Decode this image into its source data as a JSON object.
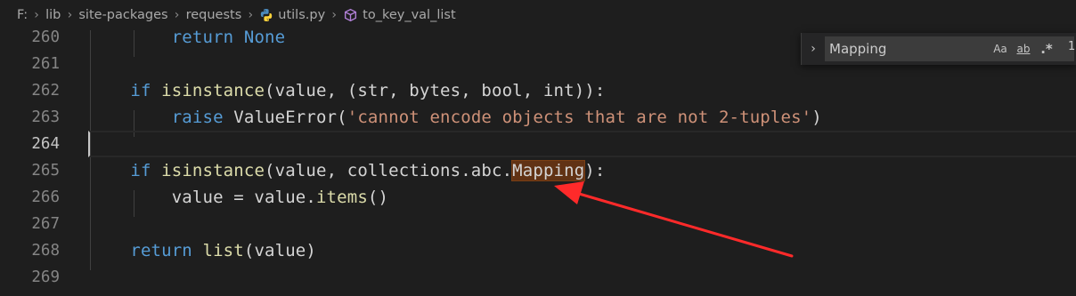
{
  "breadcrumb": {
    "items": [
      "F:",
      "lib",
      "site-packages",
      "requests",
      "utils.py",
      "to_key_val_list"
    ],
    "file_icon": "python-file-icon",
    "symbol_icon": "method-symbol-icon"
  },
  "editor": {
    "lines": [
      {
        "number": "260",
        "text": "        return None"
      },
      {
        "number": "261",
        "text": ""
      },
      {
        "number": "262",
        "text": "    if isinstance(value, (str, bytes, bool, int)):"
      },
      {
        "number": "263",
        "text": "        raise ValueError('cannot encode objects that are not 2-tuples')"
      },
      {
        "number": "264",
        "text": ""
      },
      {
        "number": "265",
        "text": "    if isinstance(value, collections.abc.Mapping):"
      },
      {
        "number": "266",
        "text": "        value = value.items()"
      },
      {
        "number": "267",
        "text": ""
      },
      {
        "number": "268",
        "text": "    return list(value)"
      },
      {
        "number": "269",
        "text": ""
      }
    ],
    "current_line": "264",
    "colors": {
      "keyword": "#569cd6",
      "function": "#dcdcaa",
      "string": "#ce9178",
      "match_highlight": "#613214",
      "annotation_arrow": "#ff2a2a"
    }
  },
  "find_widget": {
    "query": "Mapping",
    "match_case_label": "Aa",
    "whole_word_label": "ab",
    "regex_label": ".*",
    "count": "1"
  }
}
